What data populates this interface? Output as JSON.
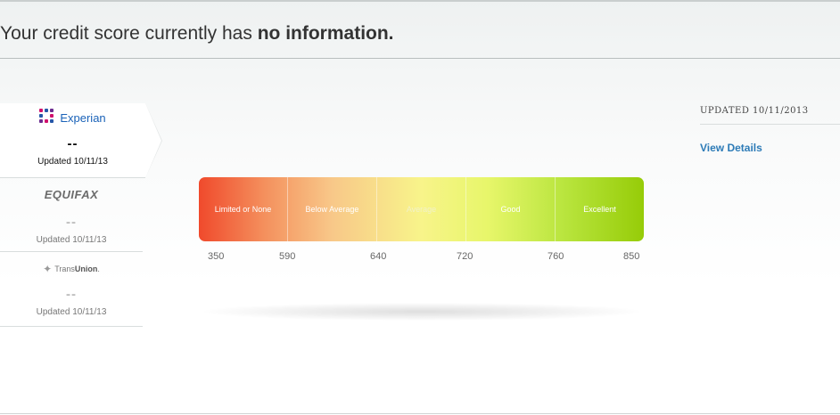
{
  "headline": {
    "prefix": "Your credit score currently has ",
    "emphasis": "no information."
  },
  "bureaus": [
    {
      "name": "Experian",
      "score": "--",
      "updated": "Updated 10/11/13",
      "active": true
    },
    {
      "name": "EQUIFAX",
      "score": "--",
      "updated": "Updated 10/11/13",
      "active": false
    },
    {
      "name_prefix": "Trans",
      "name_bold": "Union",
      "name_suffix": ".",
      "score": "--",
      "updated": "Updated 10/11/13",
      "active": false
    }
  ],
  "gauge": {
    "segments": [
      "Limited or None",
      "Below Average",
      "Average",
      "Good",
      "Excellent"
    ],
    "ticks": [
      "350",
      "590",
      "640",
      "720",
      "760",
      "850"
    ],
    "colors": {
      "start": "#f04a2c",
      "middle": "#f8f48a",
      "end": "#96cc08"
    }
  },
  "right_panel": {
    "updated_label": "UPDATED 10/11/2013",
    "view_details": "View Details"
  },
  "colors": {
    "link": "#2d7bb7",
    "experian_blue": "#1a62b8"
  },
  "icons": {
    "experian": "experian-logo-icon",
    "transunion": "transunion-logo-icon"
  }
}
